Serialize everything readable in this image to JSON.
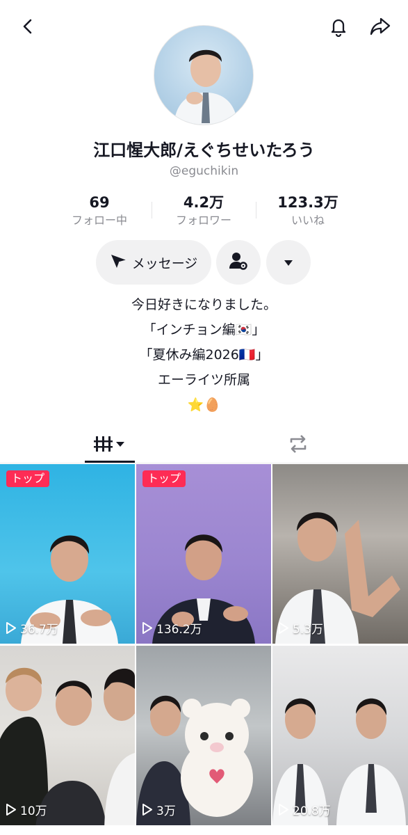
{
  "profile": {
    "display_name": "江口惺大郎/えぐちせいたろう",
    "handle": "@eguchikin"
  },
  "stats": [
    {
      "value": "69",
      "label": "フォロー中"
    },
    {
      "value": "4.2万",
      "label": "フォロワー"
    },
    {
      "value": "123.3万",
      "label": "いいね"
    }
  ],
  "actions": {
    "message_label": "メッセージ"
  },
  "bio": {
    "line1": "今日好きになりました。",
    "line2": "「インチョン編🇰🇷」",
    "line3": "「夏休み編2026🇫🇷」",
    "line4": "エーライツ所属",
    "line5": "⭐️🥚"
  },
  "videos": [
    {
      "badge": "トップ",
      "views": "36.7万"
    },
    {
      "badge": "トップ",
      "views": "136.2万"
    },
    {
      "views": "5.3万"
    },
    {
      "views": "10万"
    },
    {
      "views": "3万"
    },
    {
      "views": "20.8万"
    }
  ],
  "colors": {
    "accent": "#fe2c55",
    "text": "#161823",
    "secondary": "#8a8b91",
    "button_bg": "#f1f1f2"
  }
}
